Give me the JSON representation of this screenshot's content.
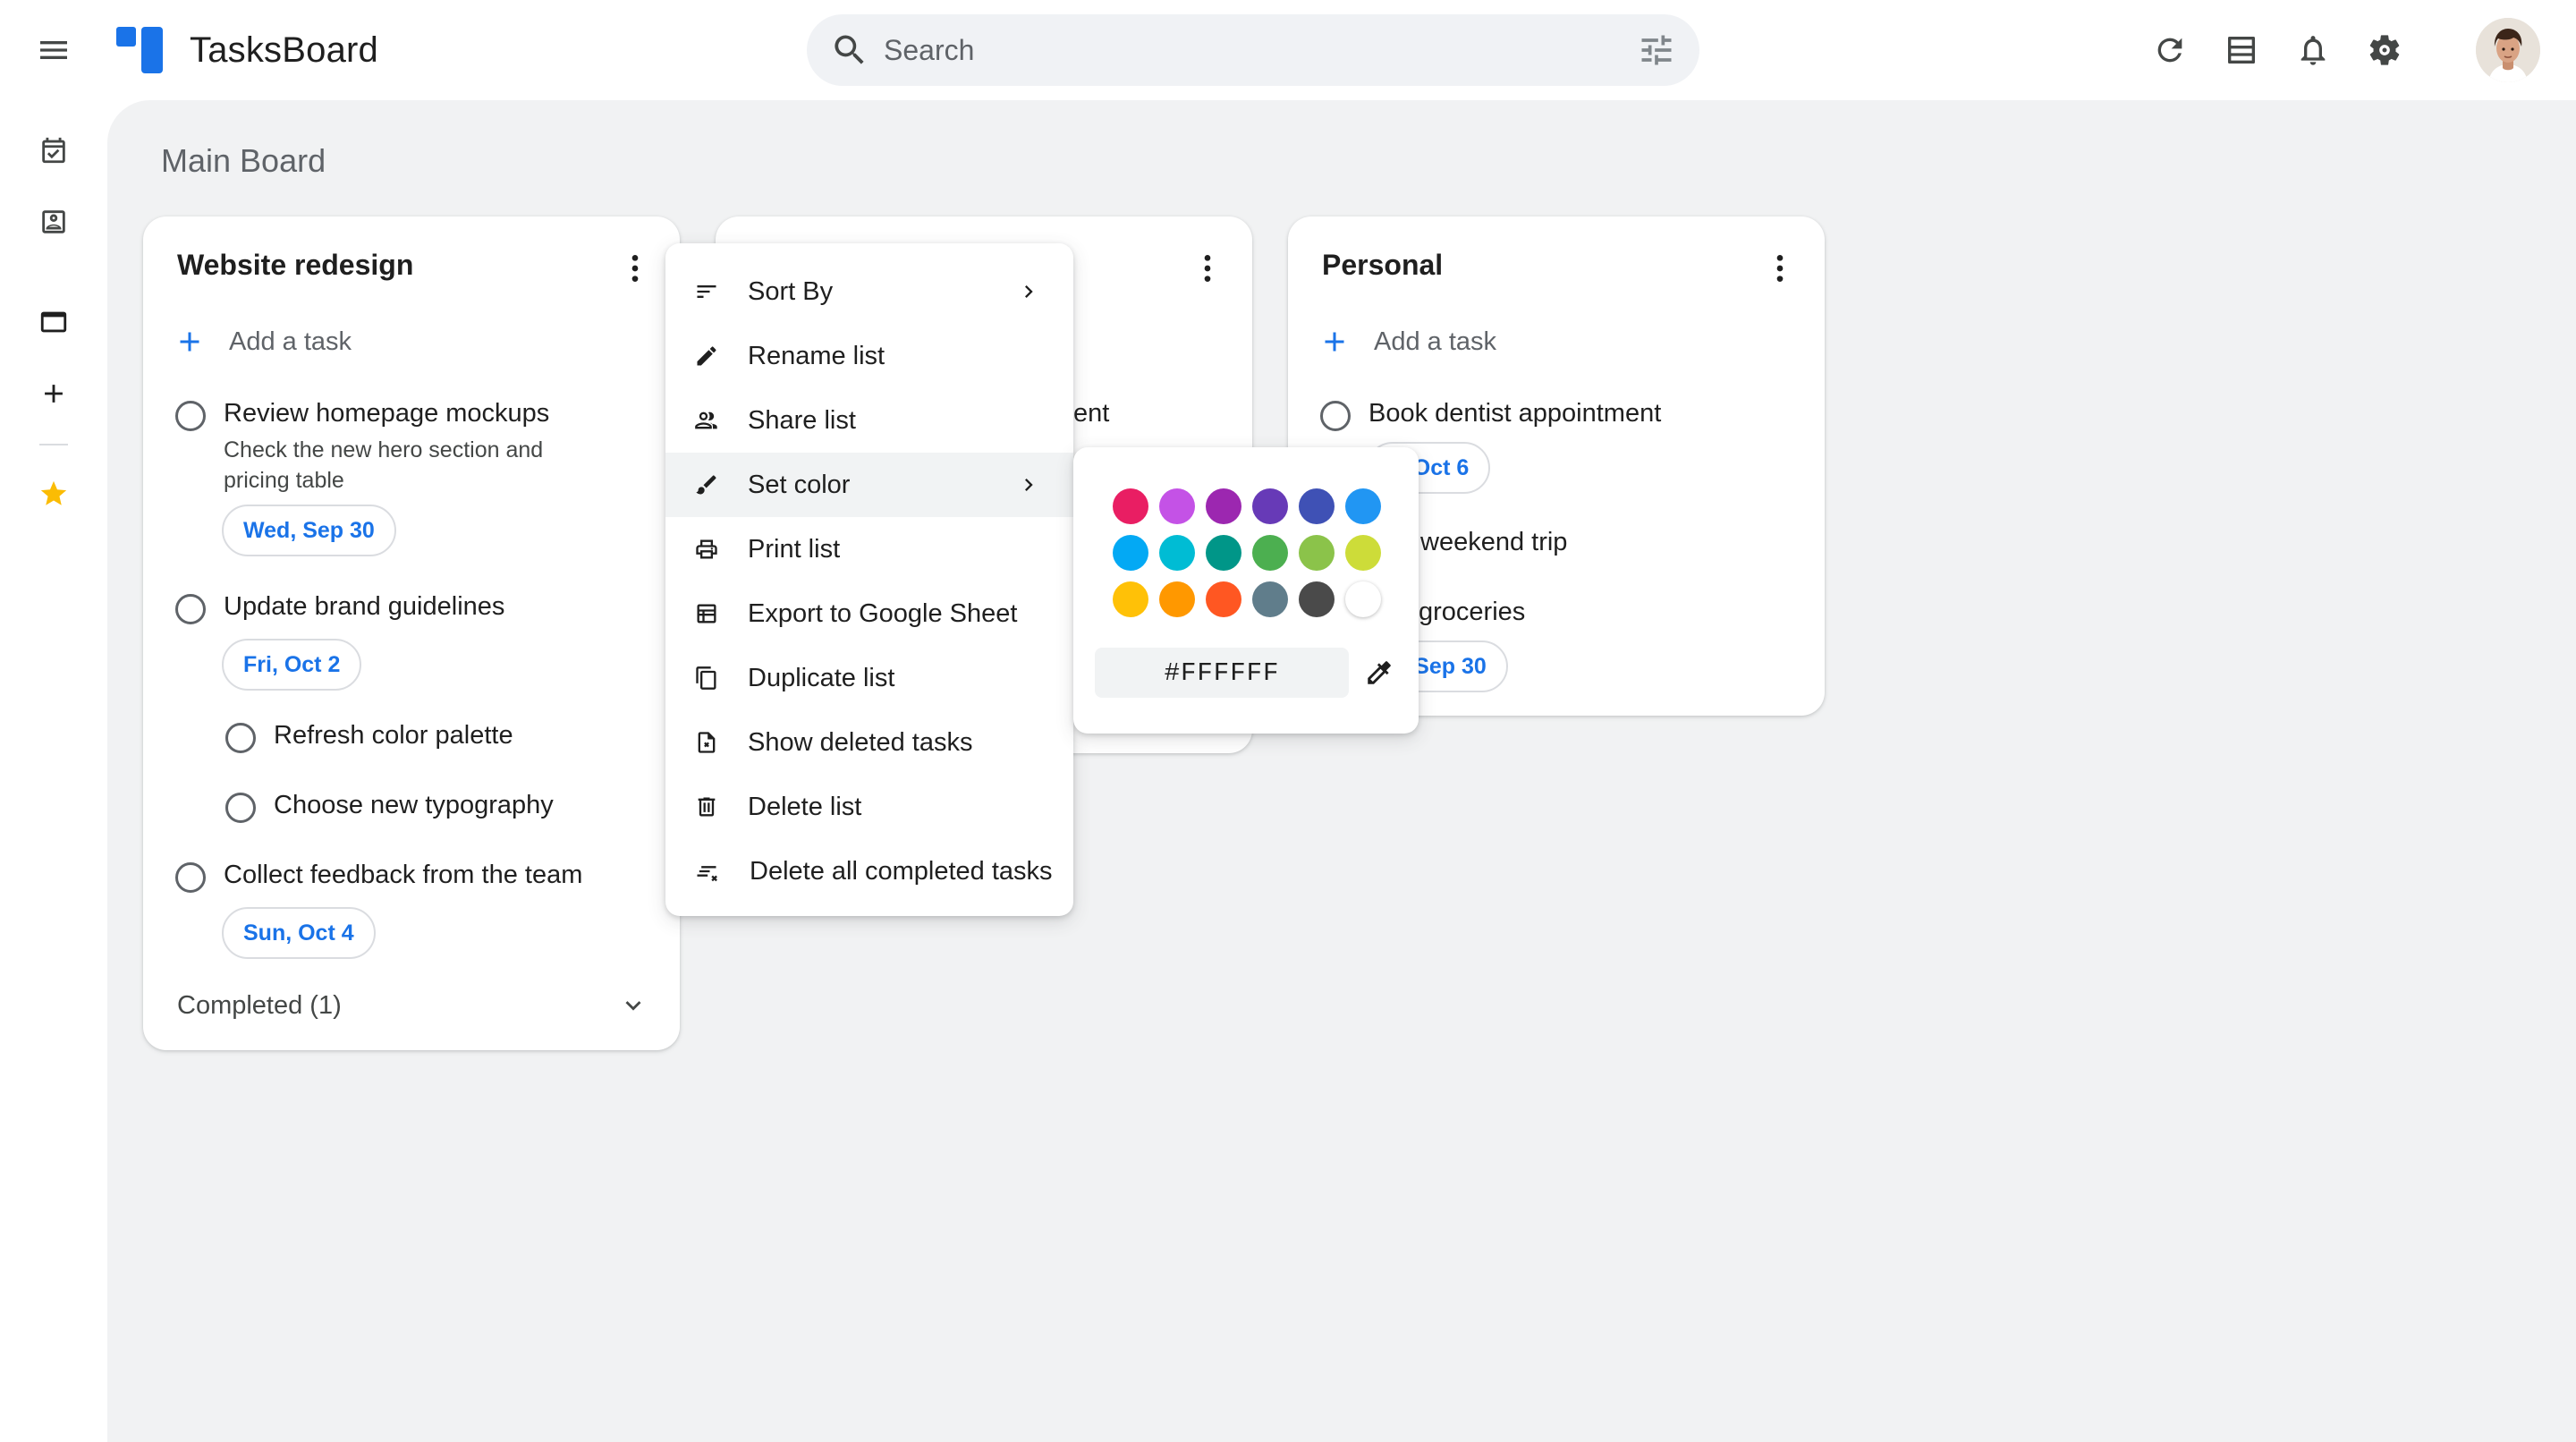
{
  "app": {
    "title": "TasksBoard"
  },
  "search": {
    "placeholder": "Search"
  },
  "topbar": {
    "icons": [
      "menu-icon",
      "refresh-icon",
      "view-toggle-icon",
      "notifications-icon",
      "settings-icon"
    ]
  },
  "rail": {
    "items": [
      "calendar-check-icon",
      "contacts-icon",
      "board-view-icon",
      "add-icon",
      "star-icon"
    ]
  },
  "board": {
    "title": "Main Board"
  },
  "lists": [
    {
      "title": "Website redesign",
      "add_task": "Add a task",
      "tasks": [
        {
          "title": "Review homepage mockups",
          "notes": "Check the new hero section and pricing table",
          "date": "Wed, Sep 30"
        },
        {
          "title": "Update brand guidelines",
          "date": "Fri, Oct 2"
        },
        {
          "title": "Refresh color palette"
        },
        {
          "title": "Choose new typography"
        },
        {
          "title": "Collect feedback from the team",
          "date": "Sun, Oct 4"
        }
      ],
      "completed": "Completed (1)"
    },
    {
      "title": "",
      "visible_fragment": "ent"
    },
    {
      "title": "Personal",
      "add_task": "Add a task",
      "tasks": [
        {
          "title": "Book dentist appointment",
          "date_fragment": "e, Oct 6"
        },
        {
          "title_fragment": "weekend trip"
        },
        {
          "title_fragment": "groceries",
          "date_fragment": "d, Sep 30"
        }
      ]
    }
  ],
  "context_menu": {
    "items": [
      {
        "label": "Sort By",
        "icon": "sort-icon",
        "submenu": true
      },
      {
        "label": "Rename list",
        "icon": "pencil-icon"
      },
      {
        "label": "Share list",
        "icon": "people-icon"
      },
      {
        "label": "Set color",
        "icon": "brush-icon",
        "submenu": true,
        "active": true
      },
      {
        "label": "Print list",
        "icon": "printer-icon"
      },
      {
        "label": "Export to Google Sheet",
        "icon": "sheet-icon"
      },
      {
        "label": "Duplicate list",
        "icon": "copy-icon"
      },
      {
        "label": "Show deleted tasks",
        "icon": "deleted-doc-icon"
      },
      {
        "label": "Delete list",
        "icon": "trash-icon"
      },
      {
        "label": "Delete all completed tasks",
        "icon": "clear-completed-icon"
      }
    ]
  },
  "color_picker": {
    "swatches": [
      [
        "#E91E63",
        "#C452E6",
        "#9C27B0",
        "#673AB7",
        "#3F51B5",
        "#2196F3"
      ],
      [
        "#03A9F4",
        "#00BCD4",
        "#009688",
        "#4CAF50",
        "#8BC34A",
        "#CDDC39"
      ],
      [
        "#FFC107",
        "#FF9800",
        "#FF5722",
        "#607D8B",
        "#4A4A4A",
        "#FFFFFF"
      ]
    ],
    "hex_value": "#FFFFFF"
  },
  "colors": {
    "accent": "#1A73E8",
    "logo_primary": "#1A73E8",
    "logo_secondary": "#1A73E8",
    "star": "#FBBC04",
    "surface": "#F1F2F3"
  }
}
